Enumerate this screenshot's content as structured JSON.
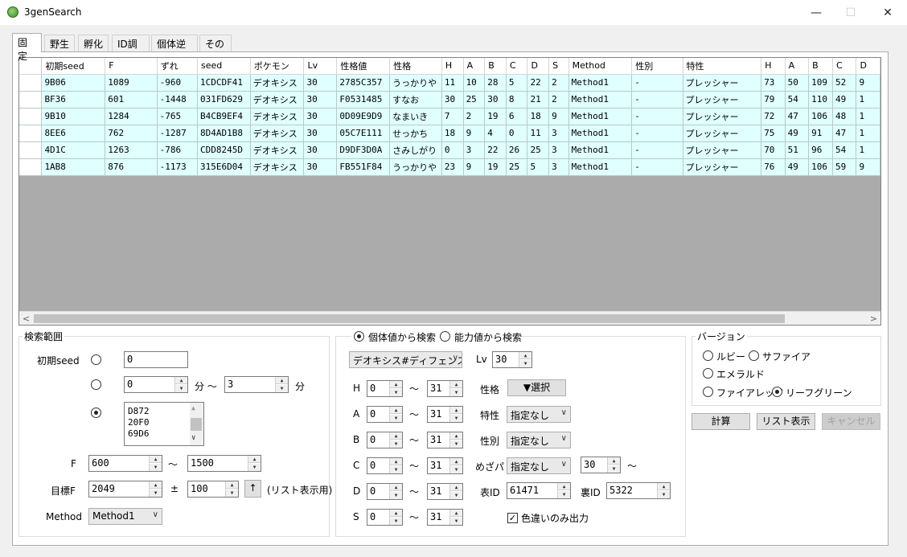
{
  "window": {
    "title": "3genSearch",
    "minimize": "—",
    "maximize": "☐",
    "close": "✕"
  },
  "tabs": [
    "固定",
    "野生",
    "孵化",
    "ID調整",
    "個体逆算",
    "その他"
  ],
  "grid": {
    "columns": [
      "初期seed",
      "F",
      "ずれ",
      "seed",
      "ポケモン",
      "Lv",
      "性格値",
      "性格",
      "H",
      "A",
      "B",
      "C",
      "D",
      "S",
      "Method",
      "性別",
      "特性",
      "H",
      "A",
      "B",
      "C",
      "D"
    ],
    "rows": [
      [
        "9B06",
        "1089",
        "-960",
        "1CDCDF41",
        "デオキシス",
        "30",
        "2785C357",
        "うっかりや",
        "11",
        "10",
        "28",
        "5",
        "22",
        "2",
        "Method1",
        "-",
        "プレッシャー",
        "73",
        "50",
        "109",
        "52",
        "9"
      ],
      [
        "BF36",
        "601",
        "-1448",
        "031FD629",
        "デオキシス",
        "30",
        "F0531485",
        "すなお",
        "30",
        "25",
        "30",
        "8",
        "21",
        "2",
        "Method1",
        "-",
        "プレッシャー",
        "79",
        "54",
        "110",
        "49",
        "1"
      ],
      [
        "9B10",
        "1284",
        "-765",
        "B4CB9EF4",
        "デオキシス",
        "30",
        "0D09E9D9",
        "なまいき",
        "7",
        "2",
        "19",
        "6",
        "18",
        "9",
        "Method1",
        "-",
        "プレッシャー",
        "72",
        "47",
        "106",
        "48",
        "1"
      ],
      [
        "8EE6",
        "762",
        "-1287",
        "8D4AD1B8",
        "デオキシス",
        "30",
        "05C7E111",
        "せっかち",
        "18",
        "9",
        "4",
        "0",
        "11",
        "3",
        "Method1",
        "-",
        "プレッシャー",
        "75",
        "49",
        "91",
        "47",
        "1"
      ],
      [
        "4D1C",
        "1263",
        "-786",
        "CDD8245D",
        "デオキシス",
        "30",
        "D9DF3D0A",
        "さみしがり",
        "0",
        "3",
        "22",
        "26",
        "25",
        "3",
        "Method1",
        "-",
        "プレッシャー",
        "70",
        "51",
        "96",
        "54",
        "1"
      ],
      [
        "1AB8",
        "876",
        "-1173",
        "315E6D04",
        "デオキシス",
        "30",
        "FB551F84",
        "うっかりや",
        "23",
        "9",
        "19",
        "25",
        "5",
        "3",
        "Method1",
        "-",
        "プレッシャー",
        "76",
        "49",
        "106",
        "59",
        "9"
      ]
    ],
    "scroll_left": "<",
    "scroll_right": ">"
  },
  "search_range": {
    "title": "検索範囲",
    "seed_label": "初期seed",
    "seed_value": "0",
    "min_from": "0",
    "min_unit": "分 〜",
    "min_to": "3",
    "min_unit2": "分",
    "seed_list": [
      "D872",
      "20F0",
      "69D6"
    ],
    "f_label": "F",
    "f_from": "600",
    "f_tilde": "〜",
    "f_to": "1500",
    "target_label": "目標F",
    "target_value": "2049",
    "pm": "±",
    "range_value": "100",
    "up_button": "↑",
    "list_note": "(リスト表示用)",
    "method_label": "Method",
    "method_value": "Method1"
  },
  "mode": {
    "iv_search": "個体値から検索",
    "stat_search": "能力値から検索"
  },
  "iv_panel": {
    "pokemon": "デオキシス#ディフェンス",
    "lv_label": "Lv",
    "lv_value": "30",
    "tilde": "〜",
    "stats": [
      {
        "label": "H",
        "from": "0",
        "to": "31"
      },
      {
        "label": "A",
        "from": "0",
        "to": "31"
      },
      {
        "label": "B",
        "from": "0",
        "to": "31"
      },
      {
        "label": "C",
        "from": "0",
        "to": "31"
      },
      {
        "label": "D",
        "from": "0",
        "to": "31"
      },
      {
        "label": "S",
        "from": "0",
        "to": "31"
      }
    ],
    "nature_label": "性格",
    "nature_button": "▼選択",
    "ability_label": "特性",
    "ability_value": "指定なし",
    "gender_label": "性別",
    "gender_value": "指定なし",
    "hp_label": "めざパ",
    "hp_value": "指定なし",
    "hp_power": "30",
    "tid_label": "表ID",
    "tid_value": "61471",
    "sid_label": "裏ID",
    "sid_value": "5322",
    "shiny_label": "色違いのみ出力"
  },
  "version": {
    "title": "バージョン",
    "ruby": "ルビー",
    "sapphire": "サファイア",
    "emerald": "エメラルド",
    "firered": "ファイアレッド",
    "leafgreen": "リーフグリーン"
  },
  "actions": {
    "calc": "計算",
    "list": "リスト表示",
    "cancel": "キャンセル"
  }
}
